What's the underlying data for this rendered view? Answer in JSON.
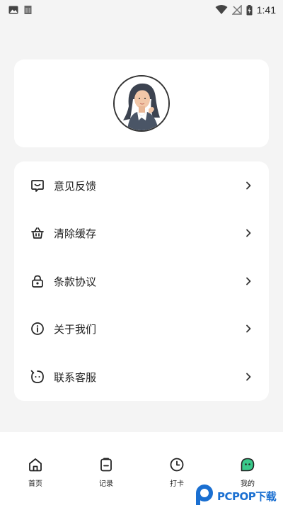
{
  "status_bar": {
    "time": "1:41",
    "left_icons": [
      "image-icon",
      "sim-icon"
    ],
    "right_icons": [
      "wifi-icon",
      "no-signal-icon",
      "battery-charging-icon"
    ]
  },
  "profile": {
    "avatar": "avatar-illustration"
  },
  "menu": {
    "items": [
      {
        "label": "意见反馈",
        "icon": "feedback-icon"
      },
      {
        "label": "清除缓存",
        "icon": "basket-icon"
      },
      {
        "label": "条款协议",
        "icon": "lock-icon"
      },
      {
        "label": "关于我们",
        "icon": "info-icon"
      },
      {
        "label": "联系客服",
        "icon": "chat-icon"
      }
    ]
  },
  "tabbar": {
    "tabs": [
      {
        "label": "首页",
        "icon": "home-icon"
      },
      {
        "label": "记录",
        "icon": "clipboard-icon"
      },
      {
        "label": "打卡",
        "icon": "clock-icon"
      },
      {
        "label": "我的",
        "icon": "profile-icon",
        "active": true
      }
    ]
  },
  "watermark": {
    "text": "PCPOP下载"
  },
  "colors": {
    "background": "#f4f4f4",
    "card": "#ffffff",
    "active_tab": "#39c98a",
    "watermark": "#1a6fd1"
  }
}
